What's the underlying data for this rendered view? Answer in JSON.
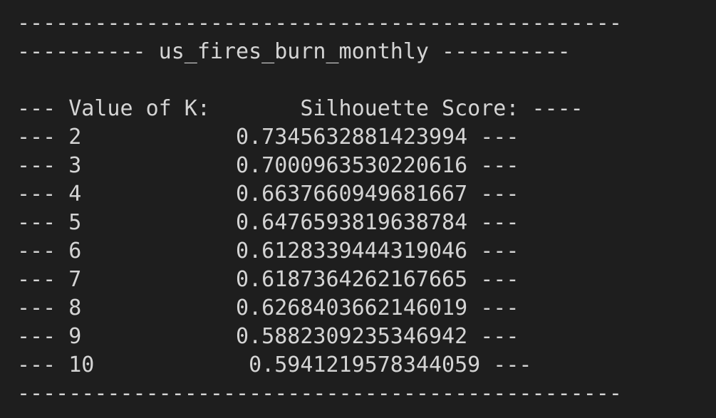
{
  "terminal": {
    "top_border": "-----------------------------------------------",
    "title_line": "---------- us_fires_burn_monthly ----------",
    "blank_line": " ",
    "header_line": "--- Value of K:       Silhouette Score: ----",
    "rows": [
      "--- 2            0.7345632881423994 ---",
      "--- 3            0.7000963530220616 ---",
      "--- 4            0.6637660949681667 ---",
      "--- 5            0.6476593819638784 ---",
      "--- 6            0.6128339444319046 ---",
      "--- 7            0.6187364262167665 ---",
      "--- 8            0.6268403662146019 ---",
      "--- 9            0.5882309235346942 ---",
      "--- 10            0.5941219578344059 ---"
    ],
    "bottom_border": "-----------------------------------------------"
  }
}
